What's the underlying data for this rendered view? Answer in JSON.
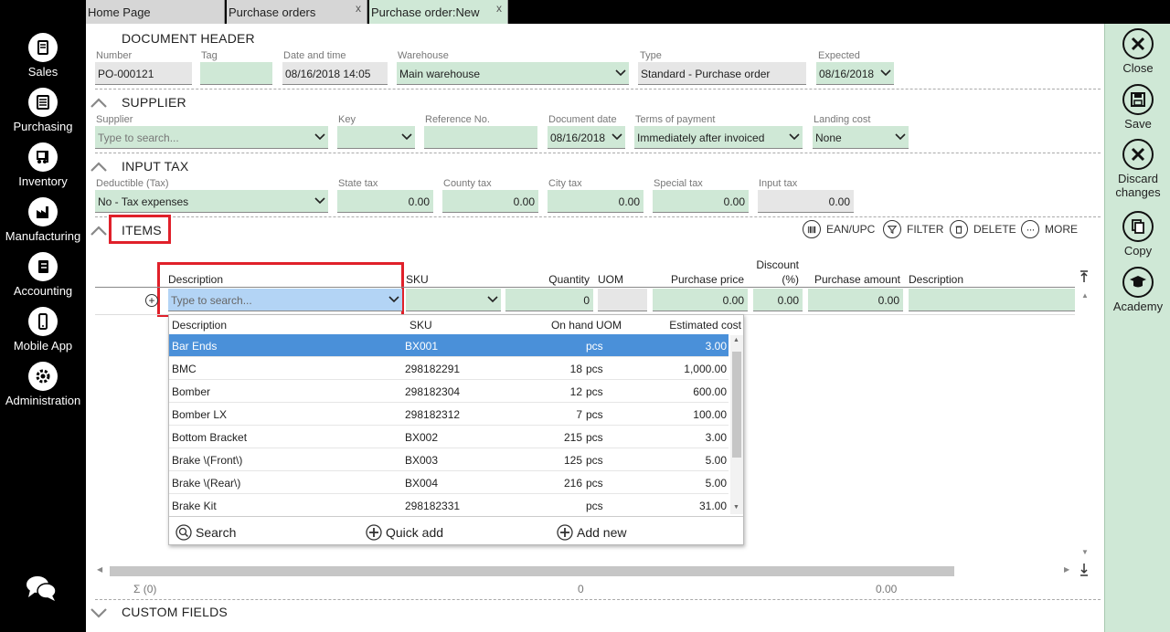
{
  "nav": {
    "items": [
      {
        "label": "Sales",
        "icon": "book-icon"
      },
      {
        "label": "Purchasing",
        "icon": "list-icon"
      },
      {
        "label": "Inventory",
        "icon": "forklift-icon"
      },
      {
        "label": "Manufacturing",
        "icon": "factory-icon"
      },
      {
        "label": "Accounting",
        "icon": "ledger-icon"
      },
      {
        "label": "Mobile App",
        "icon": "phone-icon"
      },
      {
        "label": "Administration",
        "icon": "gear-icon"
      }
    ]
  },
  "tabs": [
    {
      "label": "Home Page"
    },
    {
      "label": "Purchase orders",
      "close": "x"
    },
    {
      "label": "Purchase order:New",
      "close": "x"
    }
  ],
  "header": {
    "title": "DOCUMENT HEADER",
    "number_label": "Number",
    "number_value": "PO-000121",
    "tag_label": "Tag",
    "tag_value": "",
    "datetime_label": "Date and time",
    "datetime_value": "08/16/2018 14:05",
    "warehouse_label": "Warehouse",
    "warehouse_value": "Main warehouse",
    "type_label": "Type",
    "type_value": "Standard - Purchase order",
    "expected_label": "Expected",
    "expected_value": "08/16/2018"
  },
  "supplier": {
    "title": "SUPPLIER",
    "supplier_label": "Supplier",
    "supplier_placeholder": "Type to search...",
    "key_label": "Key",
    "ref_label": "Reference No.",
    "docdate_label": "Document date",
    "docdate_value": "08/16/2018",
    "terms_label": "Terms of payment",
    "terms_value": "Immediately after invoiced",
    "landing_label": "Landing cost",
    "landing_value": "None"
  },
  "tax": {
    "title": "INPUT TAX",
    "deductible_label": "Deductible (Tax)",
    "deductible_value": "No - Tax expenses",
    "state_label": "State tax",
    "state_value": "0.00",
    "county_label": "County tax",
    "county_value": "0.00",
    "city_label": "City tax",
    "city_value": "0.00",
    "special_label": "Special tax",
    "special_value": "0.00",
    "input_label": "Input tax",
    "input_value": "0.00"
  },
  "items": {
    "title": "ITEMS",
    "toolbar": {
      "ean": "EAN/UPC",
      "filter": "FILTER",
      "delete": "DELETE",
      "more": "MORE"
    },
    "columns": {
      "description": "Description",
      "sku": "SKU",
      "quantity": "Quantity",
      "uom": "UOM",
      "price": "Purchase price",
      "discount1": "Discount",
      "discount2": "(%)",
      "amount": "Purchase amount",
      "description2": "Description"
    },
    "newrow": {
      "placeholder": "Type to search...",
      "quantity": "0",
      "price": "0.00",
      "discount": "0.00",
      "amount": "0.00"
    },
    "footer": {
      "count": "Σ (0)",
      "qty_total": "0",
      "amount_total": "0.00"
    }
  },
  "popup": {
    "headers": {
      "description": "Description",
      "sku": "SKU",
      "onhand": "On hand",
      "uom": "UOM",
      "cost": "Estimated cost"
    },
    "rows": [
      {
        "description": "Bar Ends",
        "sku": "BX001",
        "onhand": "",
        "uom": "pcs",
        "cost": "3.00"
      },
      {
        "description": "BMC",
        "sku": "298182291",
        "onhand": "18",
        "uom": "pcs",
        "cost": "1,000.00"
      },
      {
        "description": "Bomber",
        "sku": "298182304",
        "onhand": "12",
        "uom": "pcs",
        "cost": "600.00"
      },
      {
        "description": "Bomber LX",
        "sku": "298182312",
        "onhand": "7",
        "uom": "pcs",
        "cost": "100.00"
      },
      {
        "description": "Bottom Bracket",
        "sku": "BX002",
        "onhand": "215",
        "uom": "pcs",
        "cost": "3.00"
      },
      {
        "description": "Brake \\(Front\\)",
        "sku": "BX003",
        "onhand": "125",
        "uom": "pcs",
        "cost": "5.00"
      },
      {
        "description": "Brake \\(Rear\\)",
        "sku": "BX004",
        "onhand": "216",
        "uom": "pcs",
        "cost": "5.00"
      },
      {
        "description": "Brake Kit",
        "sku": "298182331",
        "onhand": "",
        "uom": "pcs",
        "cost": "31.00"
      }
    ],
    "search": "Search",
    "quickadd": "Quick add",
    "addnew": "Add new"
  },
  "custom": {
    "title": "CUSTOM FIELDS"
  },
  "actions": [
    {
      "label1": "Close",
      "label2": "",
      "icon": "close-icon"
    },
    {
      "label1": "Save",
      "label2": "",
      "icon": "save-icon"
    },
    {
      "label1": "Discard",
      "label2": "changes",
      "icon": "discard-icon"
    },
    {
      "label1": "Copy",
      "label2": "",
      "icon": "copy-icon"
    },
    {
      "label1": "Academy",
      "label2": "",
      "icon": "academy-icon"
    }
  ],
  "colors": {
    "accent_green": "#cfe8d6",
    "selection_blue": "#4a90d9",
    "highlight_red": "#e0202a"
  }
}
